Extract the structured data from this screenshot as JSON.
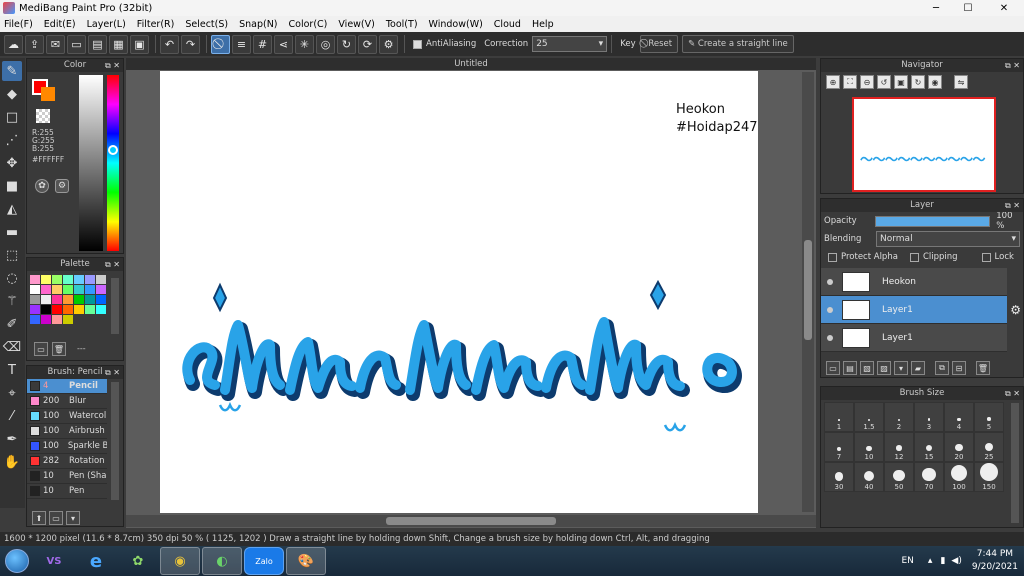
{
  "window": {
    "title": "MediBang Paint Pro (32bit)",
    "minimize": "─",
    "maximize": "☐",
    "close": "✕"
  },
  "menu": [
    "File(F)",
    "Edit(E)",
    "Layer(L)",
    "Filter(R)",
    "Select(S)",
    "Snap(N)",
    "Color(C)",
    "View(V)",
    "Tool(T)",
    "Window(W)",
    "Cloud",
    "Help"
  ],
  "toolbar": {
    "antialias_label": "AntiAliasing",
    "correction_label": "Correction",
    "correction_value": "25",
    "key_label": "Key",
    "reset_label": "Reset",
    "straight_line_label": "Create a straight line"
  },
  "color_panel": {
    "title": "Color",
    "r": "R:255",
    "g": "G:255",
    "b": "B:255",
    "hex": "#FFFFFF",
    "main_color": "#ff0000",
    "sub_color": "#ff8800"
  },
  "palette_panel": {
    "title": "Palette",
    "value": "---",
    "colors": [
      "#ff99cc",
      "#ffff66",
      "#99ff66",
      "#66ffcc",
      "#66ccff",
      "#9999ff",
      "#cccccc",
      "#ffffff",
      "#ff66cc",
      "#ffcc66",
      "#66ff66",
      "#33cccc",
      "#3399ff",
      "#cc66ff",
      "#999999",
      "#eeeeee",
      "#ff3399",
      "#ff9933",
      "#00cc00",
      "#009999",
      "#0066ff",
      "#9933ff",
      "#000000",
      "#ff0000",
      "#ff6600",
      "#ffcc00",
      "#66ff99",
      "#33ffff",
      "#3366ff",
      "#cc00cc",
      "#ff9999",
      "#cccc00"
    ]
  },
  "brush_panel": {
    "title": "Brush: Pencil",
    "items": [
      {
        "size": "4",
        "name": "Pencil",
        "color": "#3a3a3a"
      },
      {
        "size": "200",
        "name": "Blur",
        "color": "#ff88cc"
      },
      {
        "size": "100",
        "name": "Watercol",
        "color": "#66ddff"
      },
      {
        "size": "100",
        "name": "Airbrush",
        "color": "#dddddd"
      },
      {
        "size": "100",
        "name": "Sparkle B",
        "color": "#3355ff"
      },
      {
        "size": "282",
        "name": "Rotation",
        "color": "#ff3333"
      },
      {
        "size": "10",
        "name": "Pen (Sha",
        "color": "#222222"
      },
      {
        "size": "10",
        "name": "Pen",
        "color": "#222222"
      }
    ]
  },
  "document": {
    "tab": "Untitled",
    "line1": "Heokon",
    "line2": "#Hoidap247"
  },
  "navigator": {
    "title": "Navigator"
  },
  "layer_panel": {
    "title": "Layer",
    "opacity_label": "Opacity",
    "opacity_value": "100 %",
    "opacity": 1.0,
    "blending_label": "Blending",
    "blending_value": "Normal",
    "protect_alpha": "Protect Alpha",
    "clipping": "Clipping",
    "lock": "Lock",
    "layers": [
      "Heokon",
      "Layer1",
      "Layer1"
    ]
  },
  "brush_size_panel": {
    "title": "Brush Size",
    "sizes": [
      "1",
      "1.5",
      "2",
      "3",
      "4",
      "5",
      "7",
      "10",
      "12",
      "15",
      "20",
      "25",
      "30",
      "40",
      "50",
      "70",
      "100",
      "150"
    ]
  },
  "status": "1600 * 1200 pixel   (11.6 * 8.7cm)   350 dpi   50 %   ( 1125, 1202 )   Draw a straight line by holding down Shift, Change a brush size by holding down Ctrl, Alt, and dragging",
  "taskbar": {
    "apps": [
      "VS",
      "e",
      "✿",
      "◉",
      "◐",
      "Zalo",
      "🎨"
    ],
    "lang": "EN",
    "time": "7:44 PM",
    "date": "9/20/2021"
  }
}
